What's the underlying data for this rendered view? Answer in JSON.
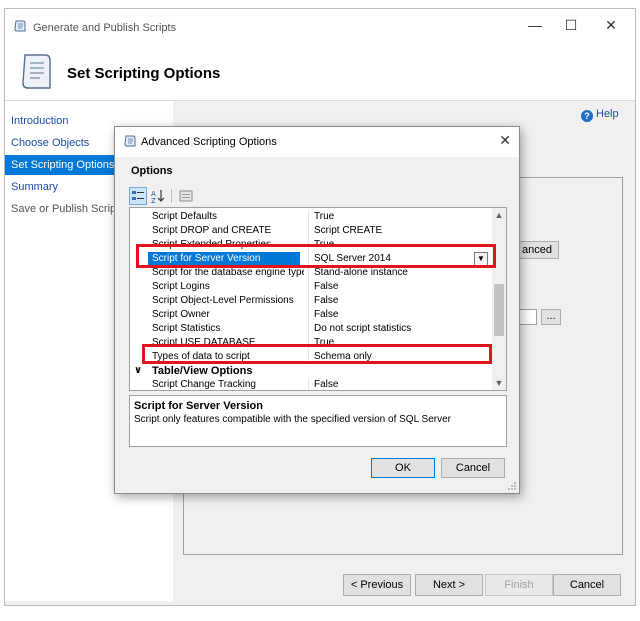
{
  "wizard": {
    "title": "Generate and Publish Scripts",
    "header_title": "Set Scripting Options",
    "help_label": "Help",
    "nav": [
      {
        "label": "Introduction",
        "state": "link"
      },
      {
        "label": "Choose Objects",
        "state": "link"
      },
      {
        "label": "Set Scripting Options",
        "state": "active"
      },
      {
        "label": "Summary",
        "state": "link"
      },
      {
        "label": "Save or Publish Scripts",
        "state": "disabled"
      }
    ],
    "background_advanced_button": "anced",
    "background_browse_button": "...",
    "footer": {
      "previous": "< Previous",
      "next": "Next >",
      "finish": "Finish",
      "cancel": "Cancel"
    }
  },
  "dialog": {
    "title": "Advanced Scripting Options",
    "section_label": "Options",
    "rows": [
      {
        "name": "Script Defaults",
        "value": "True"
      },
      {
        "name": "Script DROP and CREATE",
        "value": "Script CREATE"
      },
      {
        "name": "Script Extended Properties",
        "value": "True"
      },
      {
        "name": "Script for Server Version",
        "value": "SQL Server 2014",
        "selected": true
      },
      {
        "name": "Script for the database engine type",
        "value": "Stand-alone instance"
      },
      {
        "name": "Script Logins",
        "value": "False"
      },
      {
        "name": "Script Object-Level Permissions",
        "value": "False"
      },
      {
        "name": "Script Owner",
        "value": "False"
      },
      {
        "name": "Script Statistics",
        "value": "Do not script statistics"
      },
      {
        "name": "Script USE DATABASE",
        "value": "True"
      },
      {
        "name": "Types of data to script",
        "value": "Schema only"
      }
    ],
    "category": "Table/View Options",
    "category_rows": [
      {
        "name": "Script Change Tracking",
        "value": "False"
      }
    ],
    "description": {
      "title": "Script for Server Version",
      "text": "Script only features compatible with the specified version of SQL Server"
    },
    "ok_label": "OK",
    "cancel_label": "Cancel"
  },
  "colors": {
    "selection": "#0078d7",
    "highlight_box": "#e0141d",
    "link": "#1a4da8"
  }
}
